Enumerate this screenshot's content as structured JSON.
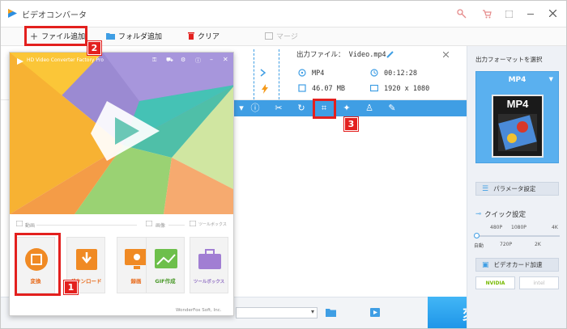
{
  "app": {
    "title": "ビデオコンバータ"
  },
  "toolbar": {
    "add_file": "ファイル追加",
    "add_folder": "フォルダ追加",
    "clear": "クリア",
    "merge": "マージ"
  },
  "file": {
    "output_file": "出力ファイル：  Video.mp4",
    "format": "MP4",
    "duration": "00:12:28",
    "size": "46.07 MB",
    "resolution": "1920 x 1080"
  },
  "popup": {
    "app_name": "HD Video Converter Factory Pro",
    "section_video": "動画",
    "section_image": "画像",
    "section_toolbox": "ツールボックス",
    "tiles": [
      "変換",
      "ダウンロード",
      "録画",
      "GIF作成",
      "ツールボックス"
    ],
    "footer": "WonderFox Soft, Inc."
  },
  "right_panel": {
    "output_format_label": "出力フォーマットを選択",
    "format_selected": "MP4",
    "thumb_label": "MP4",
    "param_settings": "パラメータ設定",
    "quick_settings": "クイック設定",
    "scale_top": [
      "480P",
      "1080P",
      "4K"
    ],
    "scale_bottom": [
      "自動",
      "720P",
      "2K"
    ],
    "gpu_accel": "ビデオカード加速",
    "nvidia": "NVIDIA",
    "intel": "intel"
  },
  "convert_label": "変換",
  "badges": [
    "1",
    "2",
    "3"
  ],
  "colors": {
    "accent": "#3f9ee4",
    "red": "#e3201e",
    "convert": "#1e95e8"
  }
}
